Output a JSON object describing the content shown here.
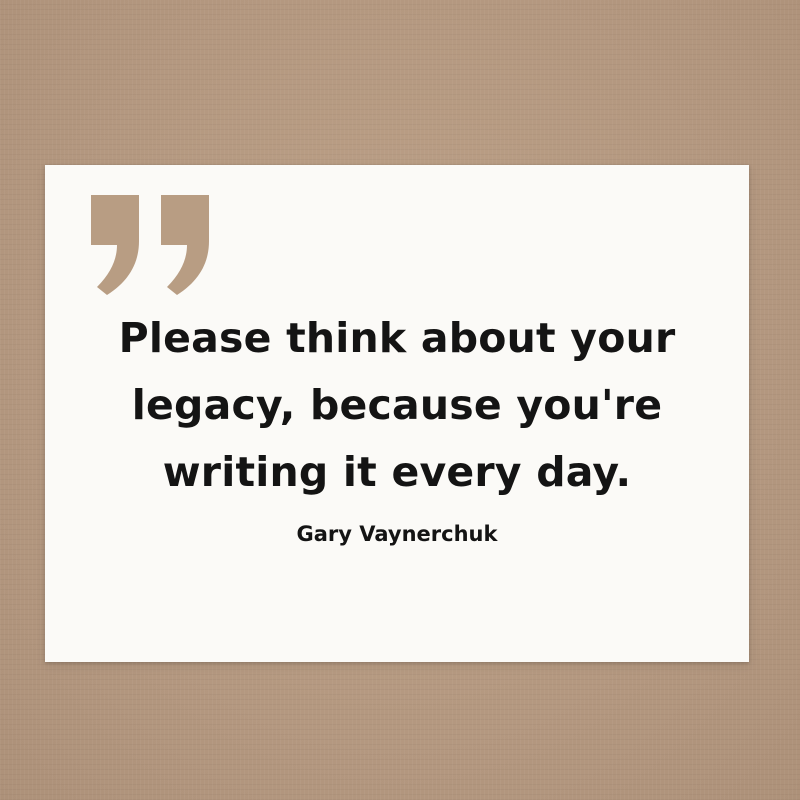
{
  "card": {
    "icon": "closing-quote-icon",
    "quote_lines": [
      "Please think about your",
      "legacy, because you're",
      "writing it every day."
    ],
    "author": "Gary Vaynerchuk"
  },
  "colors": {
    "background": "#b89d83",
    "card": "#fbfaf7",
    "quote_mark": "#b89d83",
    "text": "#141414"
  }
}
